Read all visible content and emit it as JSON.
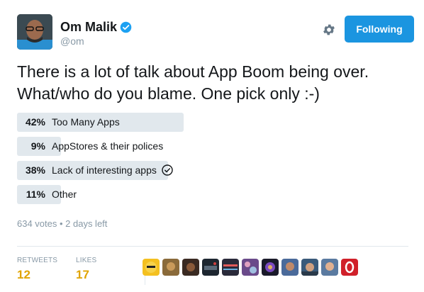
{
  "author": {
    "display_name": "Om Malik",
    "handle": "@om",
    "verified": true
  },
  "actions": {
    "follow_label": "Following"
  },
  "tweet": {
    "text": "There is a lot of talk about App Boom being over. What/who do you blame. One pick only :-)"
  },
  "poll": {
    "options": [
      {
        "percent": "42%",
        "label": "Too Many Apps",
        "value": 42,
        "selected": false
      },
      {
        "percent": "9%",
        "label": "AppStores & their polices",
        "value": 9,
        "selected": false
      },
      {
        "percent": "38%",
        "label": "Lack of interesting apps",
        "value": 38,
        "selected": true
      },
      {
        "percent": "11%",
        "label": "Other",
        "value": 11,
        "selected": false
      }
    ],
    "meta": "634 votes • 2 days left"
  },
  "stats": {
    "retweets_label": "RETWEETS",
    "retweets_count": "12",
    "likes_label": "LIKES",
    "likes_count": "17"
  },
  "colors": {
    "accent": "#1b95e0",
    "count": "#e0a400",
    "poll_bar": "#e1e8ed",
    "muted": "#8899a6"
  }
}
